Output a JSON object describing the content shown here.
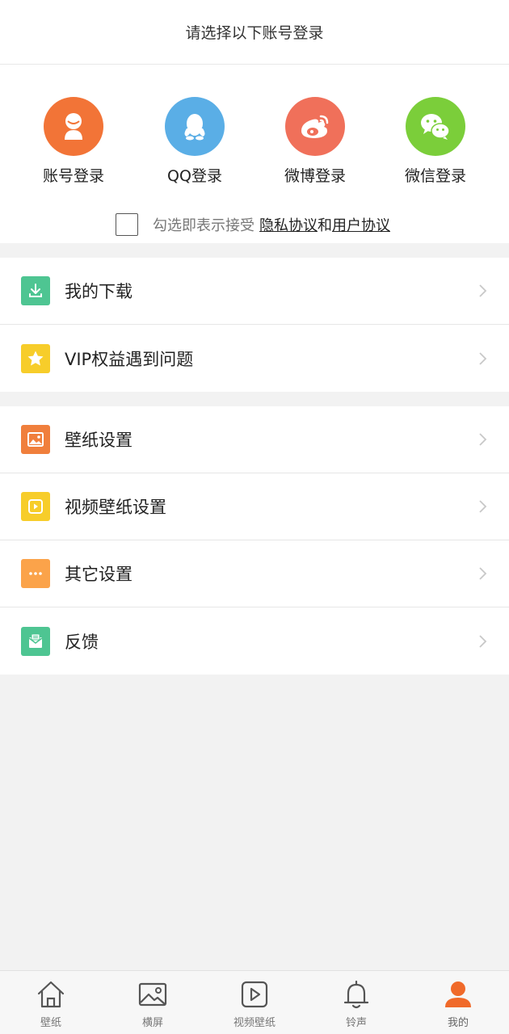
{
  "header": {
    "title": "请选择以下账号登录"
  },
  "login": {
    "options": [
      {
        "label": "账号登录",
        "icon": "account-icon",
        "color": "#f27437"
      },
      {
        "label": "QQ登录",
        "icon": "qq-icon",
        "color": "#5aaee6"
      },
      {
        "label": "微博登录",
        "icon": "weibo-icon",
        "color": "#f0705a"
      },
      {
        "label": "微信登录",
        "icon": "wechat-icon",
        "color": "#7bce3a"
      }
    ],
    "agreement": {
      "prefix": "勾选即表示接受",
      "privacy_link": "隐私协议",
      "and": "和",
      "user_link": "用户协议"
    }
  },
  "menu": {
    "section1": [
      {
        "label": "我的下载",
        "icon": "download-icon",
        "color": "#4ec592"
      },
      {
        "label": "VIP权益遇到问题",
        "icon": "star-icon",
        "color": "#f7cd2a"
      }
    ],
    "section2": [
      {
        "label": "壁纸设置",
        "icon": "image-icon",
        "color": "#f07f3c"
      },
      {
        "label": "视频壁纸设置",
        "icon": "play-icon",
        "color": "#f7cd2a"
      },
      {
        "label": "其它设置",
        "icon": "more-icon",
        "color": "#fba34a"
      },
      {
        "label": "反馈",
        "icon": "feedback-icon",
        "color": "#4ec592"
      }
    ]
  },
  "bottom_nav": [
    {
      "label": "壁纸",
      "icon": "home-icon",
      "active": false
    },
    {
      "label": "横屏",
      "icon": "landscape-image-icon",
      "active": false
    },
    {
      "label": "视频壁纸",
      "icon": "video-icon",
      "active": false
    },
    {
      "label": "铃声",
      "icon": "bell-icon",
      "active": false
    },
    {
      "label": "我的",
      "icon": "profile-icon",
      "active": true,
      "color": "#f06a2a"
    }
  ]
}
